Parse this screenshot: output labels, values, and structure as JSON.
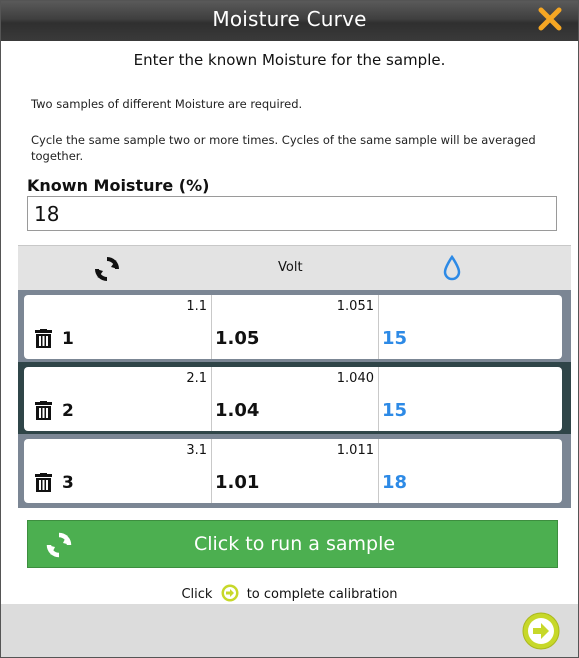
{
  "window": {
    "title": "Moisture Curve"
  },
  "instructions": {
    "subtitle": "Enter the known Moisture for the sample.",
    "note1": "Two samples of different Moisture are required.",
    "note2": "Cycle the same sample two or more times. Cycles of the same sample will be averaged together."
  },
  "known_moisture": {
    "label": "Known Moisture (%)",
    "value": "18"
  },
  "table": {
    "header": {
      "cycle_icon": "cycle-icon",
      "volt_label": "Volt",
      "moisture_icon": "water-drop-icon"
    },
    "rows": [
      {
        "cycle": "1.1",
        "index": "1",
        "raw_volt": "1.051",
        "volt": "1.05",
        "moisture": "15"
      },
      {
        "cycle": "2.1",
        "index": "2",
        "raw_volt": "1.040",
        "volt": "1.04",
        "moisture": "15"
      },
      {
        "cycle": "3.1",
        "index": "3",
        "raw_volt": "1.011",
        "volt": "1.01",
        "moisture": "18"
      }
    ]
  },
  "run_button": {
    "label": "Click to run a sample"
  },
  "hint": {
    "before": "Click",
    "after": "to complete calibration"
  },
  "colors": {
    "accent_orange": "#f5a623",
    "run_green": "#4caf50",
    "moisture_blue": "#2d8ae6",
    "next_yellow": "#c7d829",
    "selected_row": "#2f4548"
  }
}
